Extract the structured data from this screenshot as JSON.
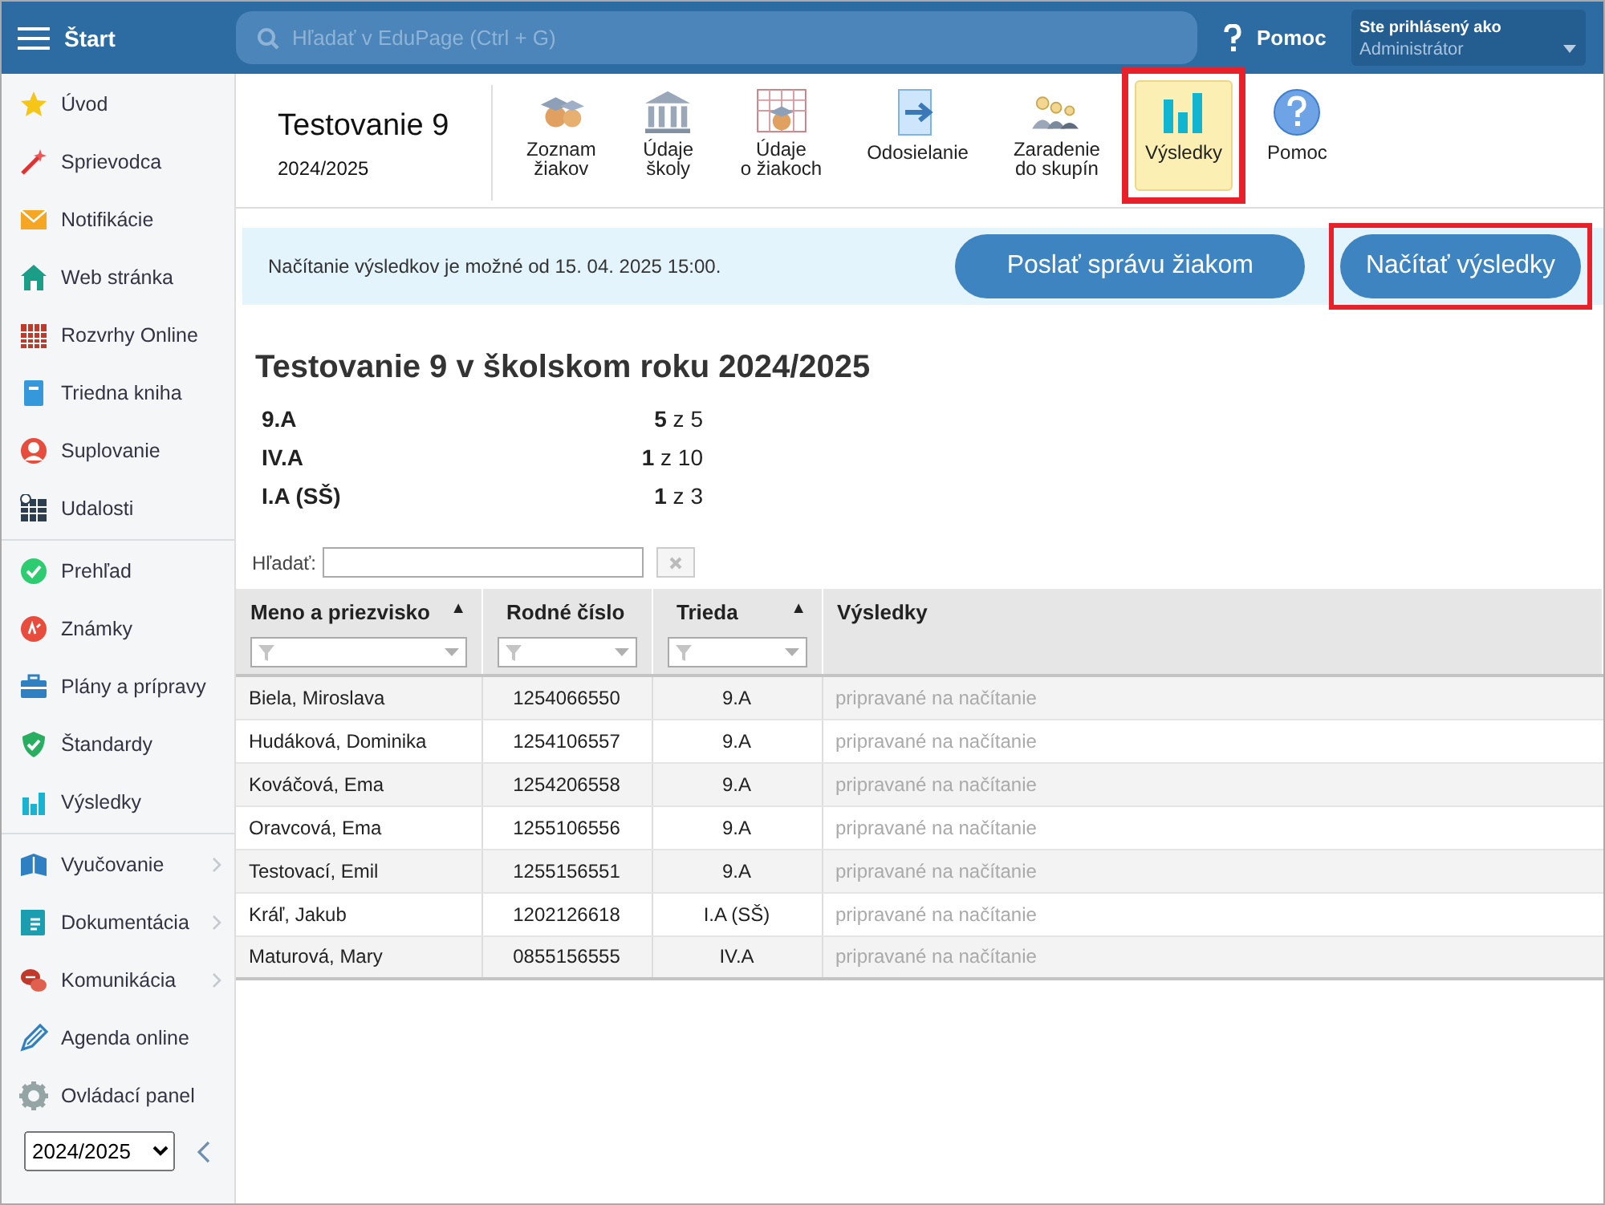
{
  "top_bar": {
    "menu_label": "Štart",
    "search": {
      "placeholder": "Hľadať v EduPage (Ctrl + G)"
    },
    "help_label": "Pomoc",
    "user": {
      "caption": "Ste prihlásený ako",
      "role": "Administrátor"
    }
  },
  "sidebar": {
    "groups": [
      [
        {
          "label": "Úvod",
          "expandable": false
        },
        {
          "label": "Sprievodca",
          "expandable": false
        },
        {
          "label": "Notifikácie",
          "expandable": false
        },
        {
          "label": "Web stránka",
          "expandable": false
        },
        {
          "label": "Rozvrhy Online",
          "expandable": false
        },
        {
          "label": "Triedna kniha",
          "expandable": false
        },
        {
          "label": "Suplovanie",
          "expandable": false
        },
        {
          "label": "Udalosti",
          "expandable": false
        }
      ],
      [
        {
          "label": "Prehľad",
          "expandable": false
        },
        {
          "label": "Známky",
          "expandable": false
        },
        {
          "label": "Plány a prípravy",
          "expandable": false
        },
        {
          "label": "Štandardy",
          "expandable": false
        },
        {
          "label": "Výsledky",
          "expandable": false
        }
      ],
      [
        {
          "label": "Vyučovanie",
          "expandable": true
        },
        {
          "label": "Dokumentácia",
          "expandable": true
        },
        {
          "label": "Komunikácia",
          "expandable": true
        },
        {
          "label": "Agenda online",
          "expandable": false
        },
        {
          "label": "Ovládací panel",
          "expandable": false
        }
      ]
    ],
    "year_select": "2024/2025"
  },
  "header": {
    "title": "Testovanie 9",
    "year": "2024/2025"
  },
  "toolbar": [
    {
      "label": "Zoznam\nžiakov",
      "selected": false,
      "highlighted": false
    },
    {
      "label": "Údaje\nškoly",
      "selected": false,
      "highlighted": false
    },
    {
      "label": "Údaje\no žiakoch",
      "selected": false,
      "highlighted": false
    },
    {
      "label": "Odosielanie",
      "selected": false,
      "highlighted": false
    },
    {
      "label": "Zaradenie\ndo skupín",
      "selected": false,
      "highlighted": false
    },
    {
      "label": "Výsledky",
      "selected": true,
      "highlighted": true
    },
    {
      "label": "Pomoc",
      "selected": false,
      "highlighted": false
    }
  ],
  "notice": {
    "text": "Načítanie výsledkov je možné od 15. 04. 2025 15:00.",
    "buttons": [
      {
        "label": "Poslať správu žiakom",
        "highlighted": false
      },
      {
        "label": "Načítať výsledky",
        "highlighted": true
      }
    ]
  },
  "summary": {
    "title": "Testovanie 9 v školskom roku 2024/2025",
    "classes": [
      {
        "name": "9.A",
        "count": "**5** z 5"
      },
      {
        "name": "IV.A",
        "count": "**1** z 10"
      },
      {
        "name": "I.A (SŠ)",
        "count": "**1** z 3"
      }
    ]
  },
  "search_label": "Hľadať:",
  "table": {
    "columns": [
      {
        "label": "Meno a priezvisko",
        "sort": "▲",
        "filter": true
      },
      {
        "label": "Rodné číslo",
        "filter": true
      },
      {
        "label": "Trieda",
        "sort": "▲",
        "filter": true
      },
      {
        "label": "Výsledky",
        "filter": false
      }
    ],
    "rows": [
      [
        "Biela, Miroslava",
        "1254066550",
        "9.A",
        "pripravané na načítanie"
      ],
      [
        "Hudáková, Dominika",
        "1254106557",
        "9.A",
        "pripravané na načítanie"
      ],
      [
        "Kováčová, Ema",
        "1254206558",
        "9.A",
        "pripravané na načítanie"
      ],
      [
        "Oravcová, Ema",
        "1255106556",
        "9.A",
        "pripravané na načítanie"
      ],
      [
        "Testovací, Emil",
        "1255156551",
        "9.A",
        "pripravané na načítanie"
      ],
      [
        "Kráľ, Jakub",
        "1202126618",
        "I.A (SŠ)",
        "pripravané na načítanie"
      ],
      [
        "Maturová, Mary",
        "0855156555",
        "IV.A",
        "pripravané na načítanie"
      ]
    ]
  }
}
